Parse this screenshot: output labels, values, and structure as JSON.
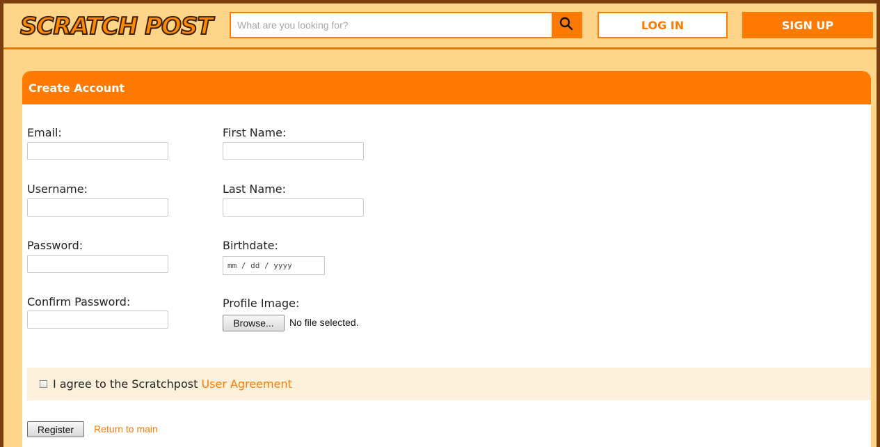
{
  "header": {
    "logo_text": "SCRATCH POST",
    "search_placeholder": "What are you looking for?",
    "login_label": "LOG IN",
    "signup_label": "SIGN UP"
  },
  "form": {
    "title": "Create Account",
    "email_label": "Email:",
    "username_label": "Username:",
    "password_label": "Password:",
    "confirm_password_label": "Confirm Password:",
    "first_name_label": "First Name:",
    "last_name_label": "Last Name:",
    "birthdate_label": "Birthdate:",
    "birthdate_placeholder": "mm / dd / yyyy",
    "profile_image_label": "Profile Image:",
    "browse_label": "Browse...",
    "no_file_text": "No file selected.",
    "agree_prefix": "I agree to the Scratchpost ",
    "agree_link": "User Agreement",
    "register_label": "Register",
    "return_label": "Return to main"
  },
  "colors": {
    "accent": "#ff7a00",
    "frame": "#7a3d0c",
    "background": "#ffd58a",
    "agree_bg": "#fdf1dc"
  },
  "icons": {
    "search": "search-icon"
  }
}
